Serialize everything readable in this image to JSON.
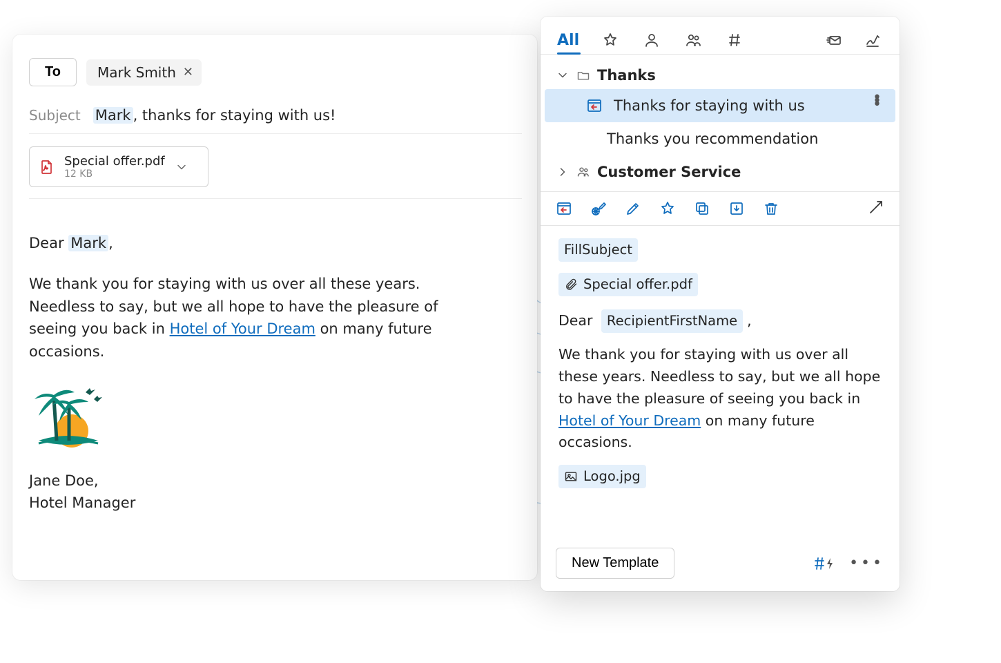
{
  "compose": {
    "to_button": "To",
    "recipient_chip": "Mark Smith",
    "subject_label": "Subject",
    "subject_name_hl": "Mark",
    "subject_rest": ", thanks for staying with us!",
    "attachment": {
      "name": "Special offer.pdf",
      "size": "12 KB"
    },
    "greeting_prefix": "Dear ",
    "greeting_name": "Mark",
    "greeting_suffix": ",",
    "body_1": "We thank you for staying with us over all these years. Needless to say, but we all hope to have the pleasure of seeing you back in ",
    "body_link": "Hotel of Your Dream",
    "body_2": " on many future occasions.",
    "sig_name": "Jane Doe,",
    "sig_title": "Hotel Manager"
  },
  "panel": {
    "tab_all": "All",
    "folder_thanks": "Thanks",
    "template_selected": "Thanks for staying with us",
    "template_other": "Thanks you recommendation",
    "folder_cs": "Customer Service",
    "preview": {
      "fill_subject": "FillSubject",
      "attachment": "Special offer.pdf",
      "greeting_prefix": "Dear",
      "recipient_token": "RecipientFirstName",
      "greeting_suffix": ",",
      "body_1": "We thank you for staying with us over all these years. Needless to say, but we all hope to have the pleasure of seeing you back in ",
      "body_link": "Hotel of Your Dream",
      "body_2": " on many future occasions.",
      "logo_token": "Logo.jpg"
    },
    "new_template": "New Template"
  }
}
